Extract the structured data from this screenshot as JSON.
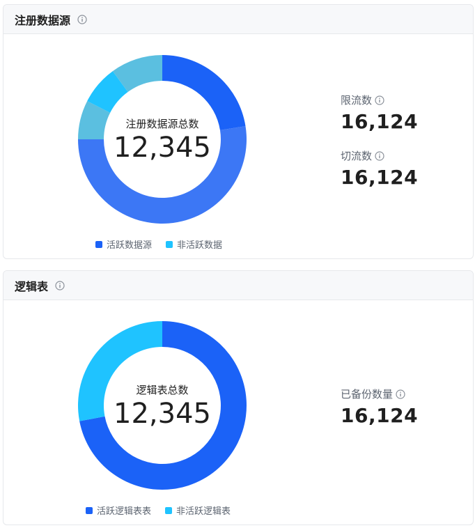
{
  "colors": {
    "primary_blue": "#1b62f7",
    "mid_blue": "#3c77f5",
    "light_cyan": "#1fc3ff",
    "sky": "#5bbfe0"
  },
  "card1": {
    "title": "注册数据源",
    "title_icon": "info-icon",
    "center_label": "注册数据源总数",
    "center_value": "12,345",
    "legend": [
      "活跃数据源",
      "非活跃数据"
    ],
    "stats": [
      {
        "label": "限流数",
        "value": "16,124",
        "icon": "info-icon"
      },
      {
        "label": "切流数",
        "value": "16,124",
        "icon": "info-icon"
      }
    ],
    "chart_data": {
      "type": "pie",
      "slices_fraction": [
        0.225,
        0.525,
        0.075,
        0.075,
        0.1
      ],
      "slice_colors": [
        "#1b62f7",
        "#3c77f5",
        "#5bbfe0",
        "#1fc3ff",
        "#5bbfe0"
      ]
    }
  },
  "card2": {
    "title": "逻辑表",
    "title_icon": "info-icon",
    "center_label": "逻辑表总数",
    "center_value": "12,345",
    "legend": [
      "活跃逻辑表表",
      "非活跃逻辑表"
    ],
    "stats": [
      {
        "label": "已备份数量",
        "value": "16,124",
        "icon": "info-icon"
      }
    ],
    "chart_data": {
      "type": "pie",
      "slices_fraction": [
        0.72,
        0.28
      ],
      "slice_colors": [
        "#1b62f7",
        "#1fc3ff"
      ]
    }
  }
}
